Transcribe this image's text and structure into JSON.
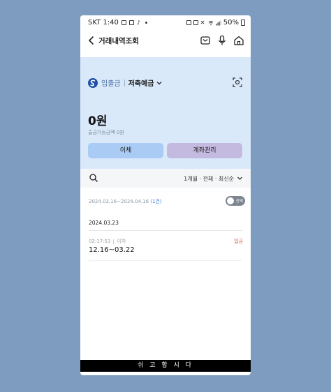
{
  "status_bar": {
    "carrier_time": "SKT 1:40",
    "battery": "50%"
  },
  "header": {
    "title": "거래내역조회",
    "icons": [
      "back-icon",
      "chat-icon",
      "mic-icon",
      "home-icon"
    ]
  },
  "account": {
    "type": "입출금",
    "name": "저축예금",
    "balance": "0원",
    "available": "출금가능금액 0원",
    "transfer_label": "이체",
    "manage_label": "계좌관리"
  },
  "filter": {
    "summary": "1개월 · 전체 · 최신순"
  },
  "history": {
    "range": "2024.03.16~2024.04.16",
    "count": "(1건)",
    "toggle_label": "잔액",
    "group_date": "2024.03.23",
    "transactions": [
      {
        "time": "02:17:53",
        "category": "이자",
        "description": "12.16~03.22",
        "type": "입금"
      }
    ]
  },
  "banner": {
    "text": "쉬 고 합 시 다"
  },
  "colors": {
    "panel_bg": "#d9e9fa",
    "transfer_button": "#a9cbf4",
    "manage_button": "#c4badf",
    "deposit_text": "#d05a4e",
    "brand": "#1d4fa6"
  }
}
